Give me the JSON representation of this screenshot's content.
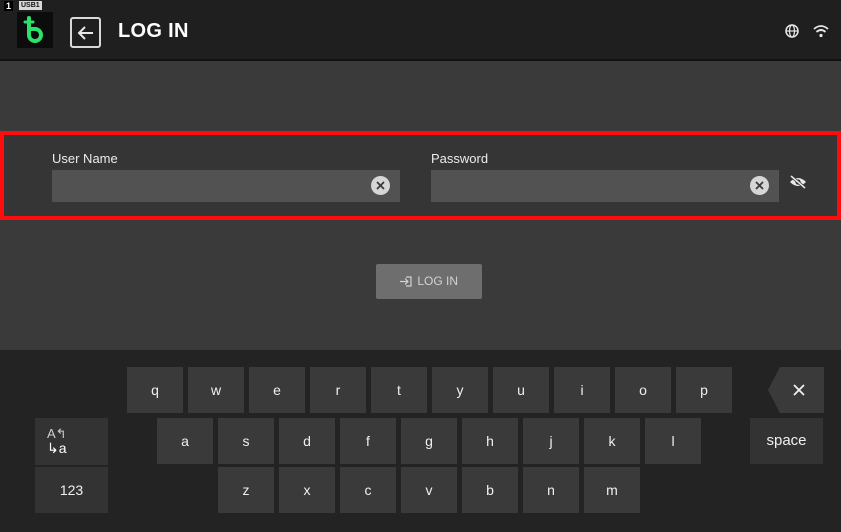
{
  "header": {
    "deck_number": "1",
    "device_tag": "USB1",
    "title": "LOG IN",
    "icons": [
      "logo-icon",
      "back-arrow-icon",
      "globe-icon",
      "wifi-icon"
    ]
  },
  "form": {
    "username_label": "User Name",
    "username_value": "",
    "password_label": "Password",
    "password_value": "",
    "highlight_color": "#ff0c0c"
  },
  "login_button": {
    "label": "LOG IN",
    "icon": "login-enter-icon",
    "enabled": false
  },
  "keyboard": {
    "row1": [
      "q",
      "w",
      "e",
      "r",
      "t",
      "y",
      "u",
      "i",
      "o",
      "p"
    ],
    "row2": [
      "a",
      "s",
      "d",
      "f",
      "g",
      "h",
      "j",
      "k",
      "l"
    ],
    "row3": [
      "z",
      "x",
      "c",
      "v",
      "b",
      "n",
      "m"
    ],
    "shift_top": "A↰",
    "shift_bottom": "↳a",
    "space_label": "space",
    "numeric_label": "123",
    "backspace_icon": "backspace-icon"
  },
  "colors": {
    "background": "#3a3a3a",
    "header": "#1f1f1f",
    "keyboard": "#232323",
    "key": "#3a3a3a",
    "logo_accent": "#2ee06a"
  }
}
